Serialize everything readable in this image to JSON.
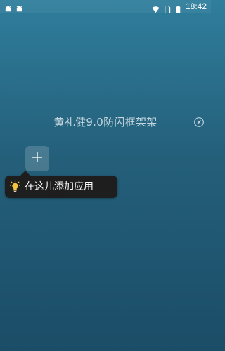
{
  "status_bar": {
    "time": "18:42",
    "left_icons": [
      "android-robot-icon",
      "android-robot-icon"
    ],
    "right_icons": [
      "wifi-icon",
      "sim-card-icon",
      "battery-icon"
    ]
  },
  "frame": {
    "title": "黄礼健9.0防闪框架架",
    "action_icon": "compass-icon"
  },
  "add_tile": {
    "icon": "plus-icon"
  },
  "tooltip": {
    "icon": "lightbulb-icon",
    "text": "在这儿添加应用"
  },
  "colors": {
    "background_top": "#2f7e9c",
    "background_bottom": "#1b4d67",
    "tooltip_bg": "#1e1e1e",
    "bulb": "#f3c443"
  }
}
